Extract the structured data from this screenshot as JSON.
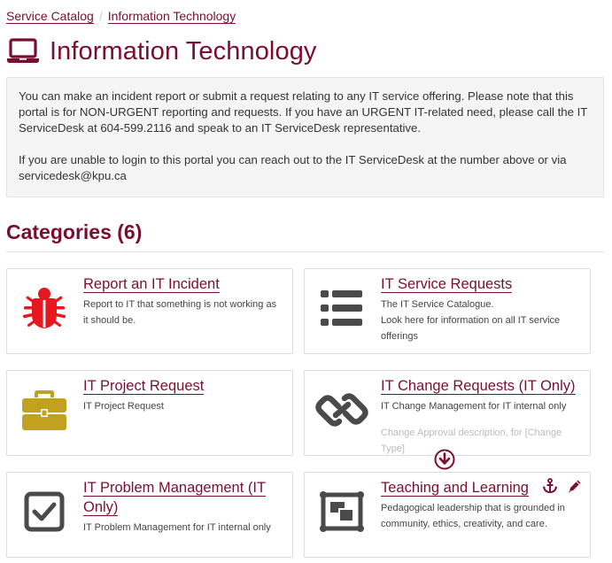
{
  "breadcrumb": {
    "items": [
      "Service Catalog",
      "Information Technology"
    ],
    "separator": "/"
  },
  "header": {
    "title": "Information Technology",
    "icon": "laptop-icon"
  },
  "notice": {
    "paragraph1": "You can make an incident report or submit a request relating to any IT service offering. Please note that this portal is for NON-URGENT reporting and requests. If you have an URGENT IT-related need, please call the IT ServiceDesk at 604-599.2116 and speak to an IT ServiceDesk representative.",
    "paragraph2": "If you are unable to login to this portal you can reach out to the IT ServiceDesk at the number above or via servicedesk@kpu.ca"
  },
  "categories": {
    "header": "Categories (6)",
    "items": [
      {
        "title": "Report an IT Incident",
        "description": "Report to IT that something is not working as it should be.",
        "icon": "bug-icon",
        "icon_color": "#e8161e"
      },
      {
        "title": "IT Service Requests",
        "description": "The IT Service Catalogue.",
        "description2": "Look here for information on all IT service offerings",
        "icon": "list-icon",
        "icon_color": "#4a4a4a"
      },
      {
        "title": "IT Project Request",
        "description": "IT Project Request",
        "icon": "briefcase-icon",
        "icon_color": "#c1a11d"
      },
      {
        "title": "IT Change Requests (IT Only)",
        "description": "IT Change Management for IT internal only",
        "description2": "Change Approval description, for [Change Type]",
        "icon": "link-icon",
        "icon_color": "#4a4a4a"
      },
      {
        "title": "IT Problem Management (IT Only)",
        "description": "IT Problem Management for IT internal only",
        "icon": "checkbox-icon",
        "icon_color": "#4a4a4a"
      },
      {
        "title": "Teaching and Learning",
        "description": "Pedagogical leadership that is grounded in community, ethics, creativity, and care.",
        "icon": "presentation-icon",
        "icon_color": "#4a4a4a"
      }
    ]
  },
  "colors": {
    "brand": "#7a0e2e",
    "notice_bg": "#f5f5f5",
    "border": "#dddddd"
  }
}
